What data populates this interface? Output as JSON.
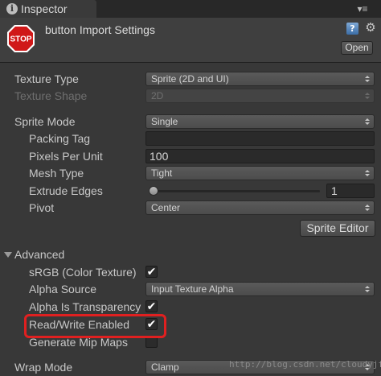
{
  "tab": {
    "title": "Inspector",
    "menu_icon": "▾≡"
  },
  "header": {
    "asset_title": "button Import Settings",
    "stop_label": "STOP",
    "help_icon": "?",
    "gear_icon": "⚙",
    "open_label": "Open"
  },
  "props": {
    "texture_type": {
      "label": "Texture Type",
      "value": "Sprite (2D and UI)"
    },
    "texture_shape": {
      "label": "Texture Shape",
      "value": "2D"
    },
    "sprite_mode": {
      "label": "Sprite Mode",
      "value": "Single"
    },
    "packing_tag": {
      "label": "Packing Tag",
      "value": ""
    },
    "pixels_per_unit": {
      "label": "Pixels Per Unit",
      "value": "100"
    },
    "mesh_type": {
      "label": "Mesh Type",
      "value": "Tight"
    },
    "extrude_edges": {
      "label": "Extrude Edges",
      "value": "1"
    },
    "pivot": {
      "label": "Pivot",
      "value": "Center"
    },
    "sprite_editor": {
      "label": "Sprite Editor"
    },
    "advanced": {
      "label": "Advanced"
    },
    "srgb": {
      "label": "sRGB (Color Texture)",
      "checked": "✔"
    },
    "alpha_source": {
      "label": "Alpha Source",
      "value": "Input Texture Alpha"
    },
    "alpha_is_transparency": {
      "label": "Alpha Is Transparency",
      "checked": "✔"
    },
    "read_write": {
      "label": "Read/Write Enabled",
      "checked": "✔"
    },
    "generate_mip_maps": {
      "label": "Generate Mip Maps",
      "checked": ""
    },
    "wrap_mode": {
      "label": "Wrap Mode",
      "value": "Clamp"
    }
  },
  "colors": {
    "highlight": "#e02020",
    "background": "#383838"
  },
  "watermark": "http://blog.csdn.net/cloudyjf"
}
